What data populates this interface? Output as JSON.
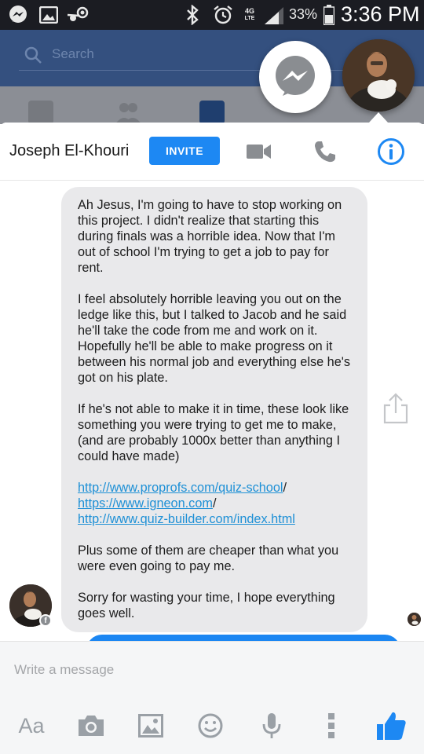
{
  "status_bar": {
    "battery_percent": "33%",
    "time": "3:36 PM",
    "network_label": "4G",
    "icons": [
      "messenger-icon",
      "gallery-icon",
      "steam-icon",
      "bluetooth-icon",
      "alarm-icon",
      "4g-lte-icon",
      "signal-icon",
      "battery-icon"
    ]
  },
  "background_app": {
    "search_placeholder": "Search"
  },
  "chat_header": {
    "contact_name": "Joseph El-Khouri",
    "invite_label": "INVITE",
    "accent_color": "#1d88f3"
  },
  "message": {
    "paragraphs": [
      "Ah Jesus, I'm going to have to stop working on this project. I didn't realize that starting this during finals was a horrible idea. Now that I'm out of school I'm trying to get a job to pay for rent.",
      "I feel absolutely horrible leaving you out on the ledge like this, but I talked to Jacob and he said he'll take the code from me and work on it. Hopefully he'll be able to make progress on it between his normal job and everything else he's got on his plate.",
      "If he's not able to make it in time, these look like something you were trying to get me to make, (and are probably 1000x better than anything I could have made)"
    ],
    "links": [
      {
        "text": "http://www.proprofs.com/quiz-school",
        "suffix": "/"
      },
      {
        "text": "https://www.igneon.com",
        "suffix": "/"
      },
      {
        "text": "http://www.quiz-builder.com/index.html",
        "suffix": ""
      }
    ],
    "closing": [
      "Plus some of them are cheaper than what you were even going to pay me.",
      "Sorry for wasting your time, I hope everything goes well."
    ],
    "sender_badge": "f"
  },
  "composer": {
    "placeholder": "Write a message"
  },
  "toolbar": {
    "text_toggle": "Aa",
    "icons": [
      "camera-icon",
      "image-icon",
      "emoji-icon",
      "microphone-icon",
      "more-icon",
      "like-icon"
    ]
  }
}
